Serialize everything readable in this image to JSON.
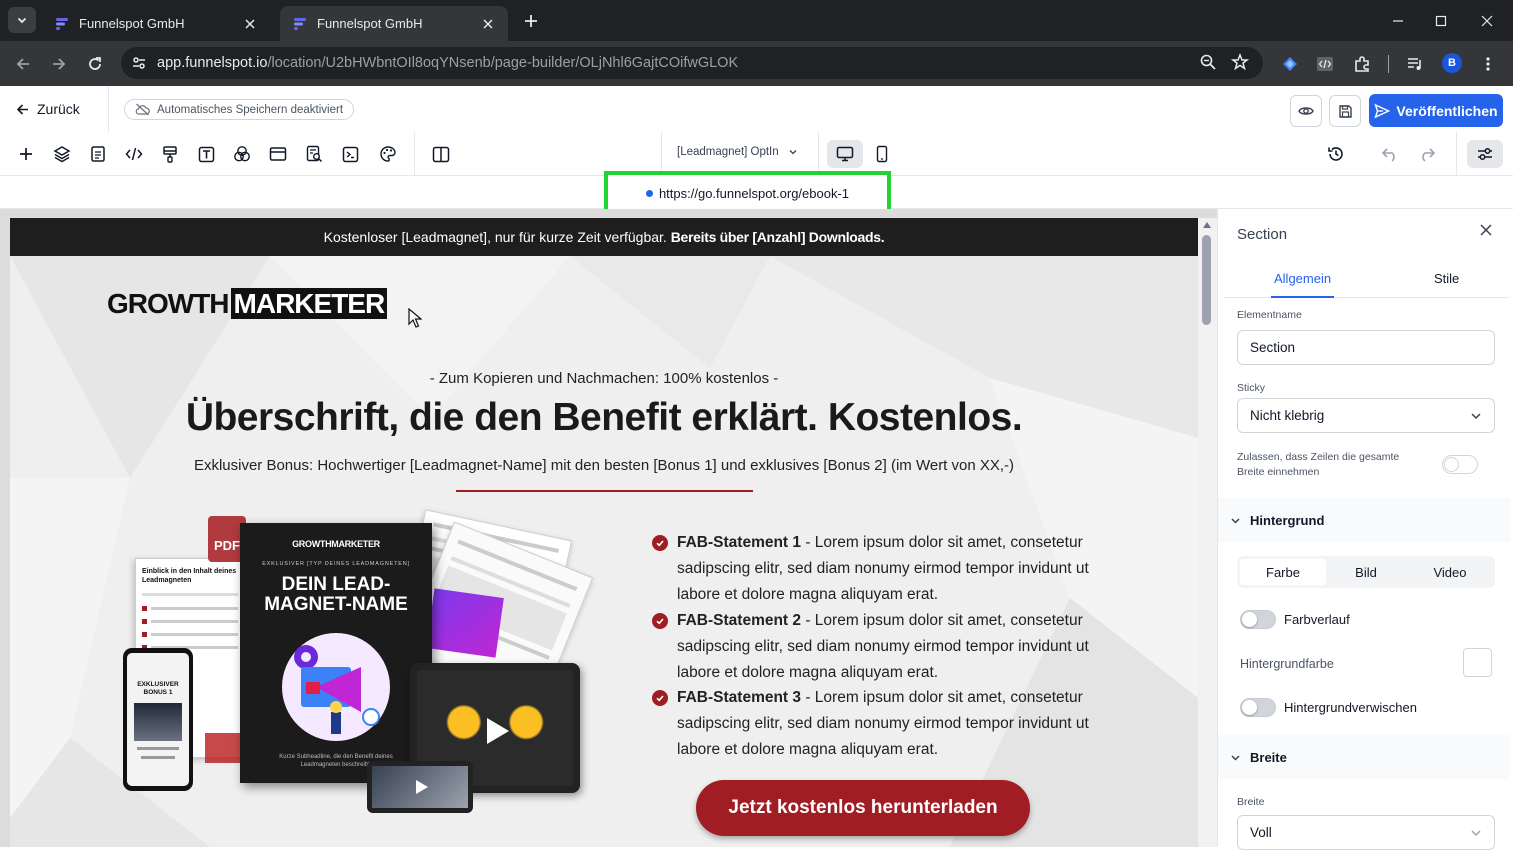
{
  "browser": {
    "tabs": [
      {
        "title": "Funnelspot GmbH",
        "active": false
      },
      {
        "title": "Funnelspot GmbH",
        "active": true
      }
    ],
    "url_host": "app.funnelspot.io",
    "url_path": "/location/U2bHWbntOIl8oqYNsenb/page-builder/OLjNhl6GajtCOifwGLOK",
    "profile_initial": "B"
  },
  "app": {
    "back_label": "Zurück",
    "autosave_label": "Automatisches Speichern deaktiviert",
    "publish_label": "Veröffentlichen",
    "page_selector": "[Leadmagnet] OptIn",
    "preview_url": "https://go.funnelspot.org/ebook-1"
  },
  "page": {
    "banner_text": "Kostenloser [Leadmagnet], nur für kurze Zeit verfügbar. ",
    "banner_bold": "Bereits über [Anzahl] Downloads.",
    "logo_left": "GROWTH",
    "logo_right": "MARKETER",
    "pre_headline": "- Zum Kopieren und Nachmachen: 100% kostenlos -",
    "headline": "Überschrift, die den Benefit erklärt. Kostenlos.",
    "subheadline": "Exklusiver Bonus: Hochwertiger [Leadmagnet-Name] mit den besten [Bonus 1] und exklusives [Bonus 2] (im Wert von XX,-)",
    "mockup": {
      "pdf_badge": "PDF",
      "book_logo": "GROWTHMARKETER",
      "book_kicker": "EXKLUSIVER [TYP DEINES LEADMAGNETEN]",
      "book_title_1": "DEIN LEAD-",
      "book_title_2": "MAGNET-NAME",
      "book_footer": "Kurze Subheadline, die den Benefit deines Leadmagneten beschreibt.",
      "sheet_title": "Einblick in den Inhalt deines Leadmagneten",
      "phone_title": "EXKLUSIVER BONUS 1"
    },
    "features": [
      {
        "bold": "FAB-Statement 1",
        "text": " - Lorem ipsum dolor sit amet, consetetur sadipscing elitr, sed diam nonumy eirmod tempor invidunt ut labore et dolore magna aliquyam erat."
      },
      {
        "bold": "FAB-Statement 2",
        "text": " - Lorem ipsum dolor sit amet, consetetur sadipscing elitr, sed diam nonumy eirmod tempor invidunt ut labore et dolore magna aliquyam erat."
      },
      {
        "bold": "FAB-Statement 3",
        "text": " - Lorem ipsum dolor sit amet, consetetur sadipscing elitr, sed diam nonumy eirmod tempor invidunt ut labore et dolore magna aliquyam erat."
      }
    ],
    "cta_label": "Jetzt kostenlos herunterladen"
  },
  "panel": {
    "title": "Section",
    "tabs": [
      "Allgemein",
      "Stile"
    ],
    "element_name_label": "Elementname",
    "element_name_value": "Section",
    "sticky_label": "Sticky",
    "sticky_value": "Nicht klebrig",
    "full_width_note": "Zulassen, dass Zeilen die gesamte Breite einnehmen",
    "background_section": "Hintergrund",
    "bg_tabs": [
      "Farbe",
      "Bild",
      "Video"
    ],
    "gradient_label": "Farbverlauf",
    "bg_color_label": "Hintergrundfarbe",
    "bg_blur_label": "Hintergrundverwischen",
    "width_section": "Breite",
    "width_label": "Breite",
    "width_value": "Voll"
  },
  "colors": {
    "accent": "#2563eb",
    "brand_red": "#a01d24",
    "highlight_green": "#22d332",
    "banner_bg": "#1e1e1e"
  }
}
